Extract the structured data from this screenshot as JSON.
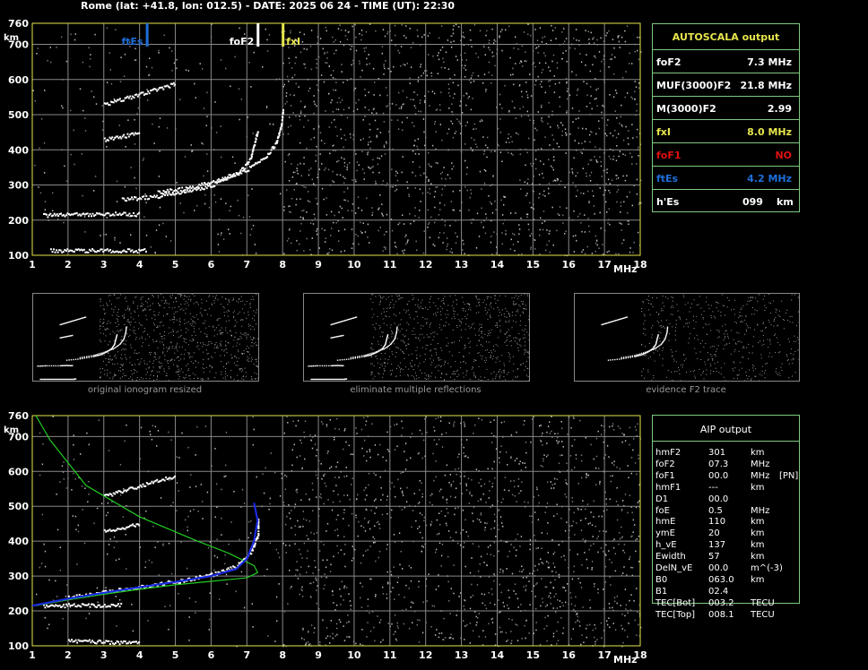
{
  "header": {
    "title": "Rome (lat: +41.8, lon: 012.5) - DATE: 2025 06 24 - TIME (UT): 22:30"
  },
  "colors": {
    "grid": "#888888",
    "frame": "#e6e64c",
    "panel_border": "#7fc97f",
    "es": "#1e6fd9",
    "fxi": "#e6e64c",
    "fof1": "#e01010",
    "model": "#22cc22",
    "profile": "#1a2ae0"
  },
  "axis": {
    "km_label": "km",
    "mhz_label": "MHz",
    "x_ticks": [
      "1",
      "2",
      "3",
      "4",
      "5",
      "6",
      "7",
      "8",
      "9",
      "10",
      "11",
      "12",
      "13",
      "14",
      "15",
      "16",
      "17",
      "18"
    ],
    "y_ticks": [
      "100",
      "200",
      "300",
      "400",
      "500",
      "600",
      "700",
      "760"
    ]
  },
  "markers": {
    "ftEs": "ftEs",
    "foF2": "foF2",
    "fxI": "fxI"
  },
  "autoscala": {
    "title": "AUTOSCALA output",
    "rows": [
      {
        "label": "foF2",
        "value": "7.3 MHz",
        "color": "#ffffff"
      },
      {
        "label": "MUF(3000)F2",
        "value": "21.8 MHz",
        "color": "#ffffff"
      },
      {
        "label": "M(3000)F2",
        "value": "2.99",
        "color": "#ffffff"
      },
      {
        "label": "fxI",
        "value": "8.0 MHz",
        "color": "#e6e64c"
      },
      {
        "label": "foF1",
        "value": "NO",
        "color": "#e01010"
      },
      {
        "label": "ftEs",
        "value": "4.2 MHz",
        "color": "#1e6fd9"
      },
      {
        "label": "h'Es",
        "value": "099",
        "unit": "km",
        "color": "#ffffff"
      }
    ]
  },
  "thumbnails": [
    {
      "caption": "original ionogram resized"
    },
    {
      "caption": "eliminate multiple reflections"
    },
    {
      "caption": "evidence F2 trace"
    }
  ],
  "aip": {
    "title": "AIP output",
    "rows": [
      {
        "name": "hmF2",
        "value": "301",
        "unit": "km",
        "flag": ""
      },
      {
        "name": "foF2",
        "value": "07.3",
        "unit": "MHz",
        "flag": ""
      },
      {
        "name": "foF1",
        "value": "00.0",
        "unit": "MHz",
        "flag": "[PN]"
      },
      {
        "name": "hmF1",
        "value": "---",
        "unit": "km",
        "flag": ""
      },
      {
        "name": "D1",
        "value": "00.0",
        "unit": "",
        "flag": ""
      },
      {
        "name": "foE",
        "value": "0.5",
        "unit": "MHz",
        "flag": ""
      },
      {
        "name": "hmE",
        "value": "110",
        "unit": "km",
        "flag": ""
      },
      {
        "name": "ymE",
        "value": "20",
        "unit": "km",
        "flag": ""
      },
      {
        "name": "h_vE",
        "value": "137",
        "unit": "km",
        "flag": ""
      },
      {
        "name": "Ewidth",
        "value": "57",
        "unit": "km",
        "flag": ""
      },
      {
        "name": "DelN_vE",
        "value": "00.0",
        "unit": "m^(-3)",
        "flag": ""
      },
      {
        "name": "B0",
        "value": "063.0",
        "unit": "km",
        "flag": ""
      },
      {
        "name": "B1",
        "value": "02.4",
        "unit": "",
        "flag": ""
      },
      {
        "name": "TEC[Bot]",
        "value": "003.2",
        "unit": "TECU",
        "flag": ""
      },
      {
        "name": "TEC[Top]",
        "value": "008.1",
        "unit": "TECU",
        "flag": ""
      }
    ]
  },
  "chart_data": [
    {
      "type": "scatter",
      "name": "autoscala ionogram",
      "xlabel": "MHz",
      "ylabel": "km",
      "xlim": [
        1,
        18
      ],
      "ylim": [
        100,
        760
      ],
      "grid": true,
      "markers": [
        {
          "label": "ftEs",
          "x": 4.2
        },
        {
          "label": "foF2",
          "x": 7.3
        },
        {
          "label": "fxI",
          "x": 8.0
        }
      ],
      "traces": [
        {
          "name": "Es",
          "points": [
            [
              1.5,
              115
            ],
            [
              2,
              115
            ],
            [
              2.5,
              115
            ],
            [
              3,
              115
            ],
            [
              3.5,
              115
            ],
            [
              4,
              115
            ],
            [
              4.2,
              118
            ]
          ]
        },
        {
          "name": "E",
          "points": [
            [
              1.3,
              215
            ],
            [
              2,
              218
            ],
            [
              3,
              218
            ],
            [
              3.5,
              220
            ],
            [
              4,
              218
            ]
          ]
        },
        {
          "name": "F2-o",
          "points": [
            [
              3.5,
              260
            ],
            [
              4.5,
              270
            ],
            [
              5.5,
              288
            ],
            [
              6,
              300
            ],
            [
              6.5,
              322
            ],
            [
              6.9,
              350
            ],
            [
              7.1,
              380
            ],
            [
              7.2,
              420
            ],
            [
              7.3,
              460
            ]
          ]
        },
        {
          "name": "F2-x",
          "points": [
            [
              4.5,
              280
            ],
            [
              5.5,
              296
            ],
            [
              6.3,
              320
            ],
            [
              7,
              345
            ],
            [
              7.5,
              380
            ],
            [
              7.8,
              420
            ],
            [
              7.95,
              470
            ],
            [
              8,
              520
            ]
          ]
        },
        {
          "name": "F2-2hop",
          "points": [
            [
              3,
              530
            ],
            [
              3.5,
              545
            ],
            [
              4,
              560
            ],
            [
              4.5,
              575
            ],
            [
              5,
              590
            ]
          ]
        },
        {
          "name": "faint",
          "points": [
            [
              3,
              430
            ],
            [
              3.5,
              440
            ],
            [
              4,
              450
            ]
          ]
        }
      ]
    },
    {
      "type": "line",
      "name": "aip profile",
      "xlabel": "MHz",
      "ylabel": "km",
      "xlim": [
        1,
        18
      ],
      "ylim": [
        100,
        760
      ],
      "grid": true,
      "series": [
        {
          "name": "model",
          "points": [
            [
              1.1,
              760
            ],
            [
              1.5,
              690
            ],
            [
              2.5,
              560
            ],
            [
              4,
              470
            ],
            [
              5.5,
              405
            ],
            [
              6.5,
              365
            ],
            [
              7.2,
              330
            ],
            [
              7.3,
              310
            ],
            [
              7,
              295
            ],
            [
              6,
              285
            ],
            [
              5,
              275
            ],
            [
              4,
              262
            ],
            [
              3,
              248
            ],
            [
              2,
              232
            ],
            [
              1.1,
              215
            ]
          ]
        },
        {
          "name": "profile",
          "points": [
            [
              1,
              215
            ],
            [
              2,
              235
            ],
            [
              3,
              252
            ],
            [
              4,
              268
            ],
            [
              5,
              283
            ],
            [
              6,
              300
            ],
            [
              6.7,
              320
            ],
            [
              7,
              350
            ],
            [
              7.2,
              400
            ],
            [
              7.3,
              460
            ],
            [
              7.2,
              510
            ]
          ]
        }
      ],
      "traces": [
        {
          "name": "Es",
          "points": [
            [
              2,
              115
            ],
            [
              2.5,
              115
            ],
            [
              3,
              113
            ],
            [
              3.5,
              112
            ],
            [
              4,
              113
            ]
          ]
        },
        {
          "name": "E",
          "points": [
            [
              1.3,
              215
            ],
            [
              2,
              218
            ],
            [
              3,
              218
            ],
            [
              3.5,
              220
            ]
          ]
        },
        {
          "name": "F2-o",
          "points": [
            [
              2,
              240
            ],
            [
              3,
              255
            ],
            [
              4,
              270
            ],
            [
              5,
              285
            ],
            [
              6,
              305
            ],
            [
              6.7,
              330
            ],
            [
              7.1,
              370
            ],
            [
              7.3,
              420
            ],
            [
              7.3,
              470
            ]
          ]
        },
        {
          "name": "F2-2hop",
          "points": [
            [
              3,
              530
            ],
            [
              3.5,
              545
            ],
            [
              4,
              560
            ],
            [
              4.5,
              575
            ],
            [
              5,
              590
            ]
          ]
        },
        {
          "name": "faint",
          "points": [
            [
              3,
              430
            ],
            [
              3.5,
              440
            ],
            [
              4,
              450
            ]
          ]
        }
      ]
    }
  ]
}
